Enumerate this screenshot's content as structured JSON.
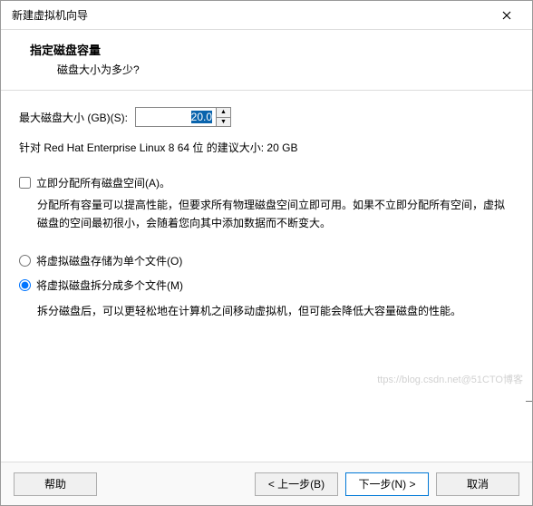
{
  "titlebar": {
    "title": "新建虚拟机向导"
  },
  "header": {
    "title": "指定磁盘容量",
    "sub": "磁盘大小为多少?"
  },
  "disk": {
    "label": "最大磁盘大小 (GB)(S):",
    "value": "20.0"
  },
  "recommend": "针对 Red Hat Enterprise Linux 8 64 位 的建议大小: 20 GB",
  "allocate": {
    "label": "立即分配所有磁盘空间(A)。",
    "desc": "分配所有容量可以提高性能，但要求所有物理磁盘空间立即可用。如果不立即分配所有空间，虚拟磁盘的空间最初很小，会随着您向其中添加数据而不断变大。"
  },
  "store": {
    "single": "将虚拟磁盘存储为单个文件(O)",
    "split": "将虚拟磁盘拆分成多个文件(M)",
    "split_desc": "拆分磁盘后，可以更轻松地在计算机之间移动虚拟机，但可能会降低大容量磁盘的性能。"
  },
  "footer": {
    "help": "帮助",
    "back": "< 上一步(B)",
    "next": "下一步(N) >",
    "cancel": "取消"
  },
  "watermark": "ttps://blog.csdn.net@51CTO博客"
}
